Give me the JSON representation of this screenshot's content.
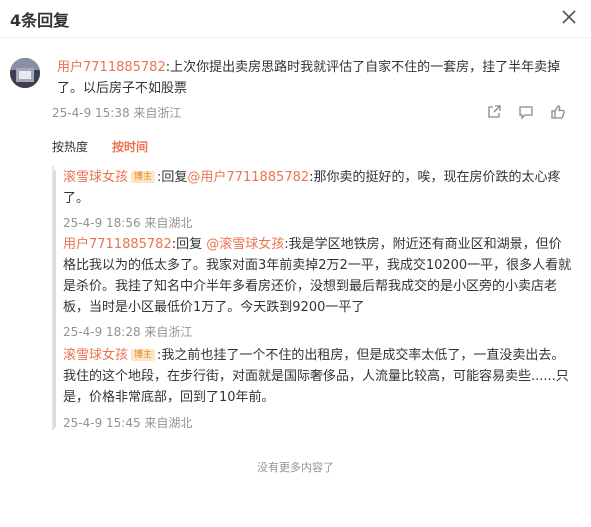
{
  "header": {
    "title": "4条回复"
  },
  "main_comment": {
    "user": "用户7711885782",
    "text": ":上次你提出卖房思路时我就评估了自家不住的一套房，挂了半年卖掉了。以后房子不如股票",
    "meta": "25-4-9 15:38 来自浙江"
  },
  "sort": {
    "by_hot": "按热度",
    "by_time": "按时间"
  },
  "replies": [
    {
      "user": "滚雪球女孩",
      "badge": "博主",
      "prefix": ":回复",
      "mention": "@用户7711885782",
      "text": ":那你卖的挺好的，唉，现在房价跌的太心疼了。",
      "meta": "25-4-9 18:56 来自湖北"
    },
    {
      "user": "用户7711885782",
      "prefix": ":回复 ",
      "mention": "@滚雪球女孩",
      "text": ":我是学区地铁房，附近还有商业区和湖景，但价格比我以为的低太多了。我家对面3年前卖掉2万2一平，我成交10200一平，很多人看就是杀价。我挂了知名中介半年多看房还价，没想到最后帮我成交的是小区旁的小卖店老板，当时是小区最低价1万了。今天跌到9200一平了",
      "meta": "25-4-9 18:28 来自浙江"
    },
    {
      "user": "滚雪球女孩",
      "badge": "博主",
      "text": ":我之前也挂了一个不住的出租房，但是成交率太低了，一直没卖出去。我住的这个地段，在步行街，对面就是国际奢侈品，人流量比较高，可能容易卖些......只是，价格非常底部，回到了10年前。",
      "meta": "25-4-9 15:45 来自湖北"
    }
  ],
  "footer": {
    "no_more": "没有更多内容了"
  }
}
